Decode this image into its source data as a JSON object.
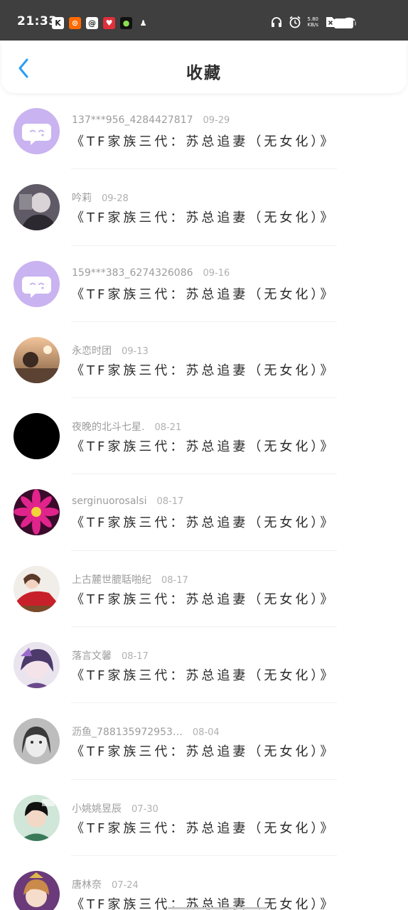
{
  "status_bar": {
    "time": "21:33",
    "net_speed_value": "5.80",
    "net_speed_unit": "KB/s",
    "app_icons": [
      {
        "name": "k-app-icon",
        "glyph": "K",
        "color": "#ffffff",
        "fg": "#222222"
      },
      {
        "name": "kuaishou-icon",
        "glyph": "⊙",
        "color": "#ff6a00",
        "fg": "#ffffff"
      },
      {
        "name": "at-app-icon",
        "glyph": "@",
        "color": "#ffffff",
        "fg": "#222222"
      },
      {
        "name": "heart-app-icon",
        "glyph": "♥",
        "color": "#e0303a",
        "fg": "#ffffff"
      },
      {
        "name": "green-dot-app-icon",
        "glyph": "●",
        "color": "#111111",
        "fg": "#8be04e"
      },
      {
        "name": "qq-icon",
        "glyph": "♟",
        "color": "transparent",
        "fg": "#ffffff"
      }
    ]
  },
  "header": {
    "title": "收藏"
  },
  "colors": {
    "accent": "#2a9df4",
    "chat_avatar_bg": "#c9b3f0"
  },
  "items": [
    {
      "user": "137***956_4284427817",
      "date": "09-29",
      "title": "《TF家族三代：苏总追妻（无女化）》",
      "avatar": "chat-bubble-avatar"
    },
    {
      "user": "吟莉",
      "date": "09-28",
      "title": "《TF家族三代：苏总追妻（无女化）》",
      "avatar": "user-avatar"
    },
    {
      "user": "159***383_6274326086",
      "date": "09-16",
      "title": "《TF家族三代：苏总追妻（无女化）》",
      "avatar": "chat-bubble-avatar"
    },
    {
      "user": "永恋时团",
      "date": "09-13",
      "title": "《TF家族三代：苏总追妻（无女化）》",
      "avatar": "user-avatar"
    },
    {
      "user": "夜晚的北斗七星.",
      "date": "08-21",
      "title": "《TF家族三代：苏总追妻（无女化）》",
      "avatar": "user-avatar"
    },
    {
      "user": "serginuorosalsi",
      "date": "08-17",
      "title": "《TF家族三代：苏总追妻（无女化）》",
      "avatar": "user-avatar"
    },
    {
      "user": "上古麓世膍聒啪纪",
      "date": "08-17",
      "title": "《TF家族三代：苏总追妻（无女化）》",
      "avatar": "user-avatar"
    },
    {
      "user": "落言文馨",
      "date": "08-17",
      "title": "《TF家族三代：苏总追妻（无女化）》",
      "avatar": "user-avatar"
    },
    {
      "user": "沥鱼_788135972953…",
      "date": "08-04",
      "title": "《TF家族三代：苏总追妻（无女化）》",
      "avatar": "user-avatar"
    },
    {
      "user": "小姚姚昱辰",
      "date": "07-30",
      "title": "《TF家族三代：苏总追妻（无女化）》",
      "avatar": "user-avatar"
    },
    {
      "user": "唐林奈",
      "date": "07-24",
      "title": "《TF家族三代：苏总追妻（无女化）》",
      "avatar": "user-avatar"
    }
  ]
}
